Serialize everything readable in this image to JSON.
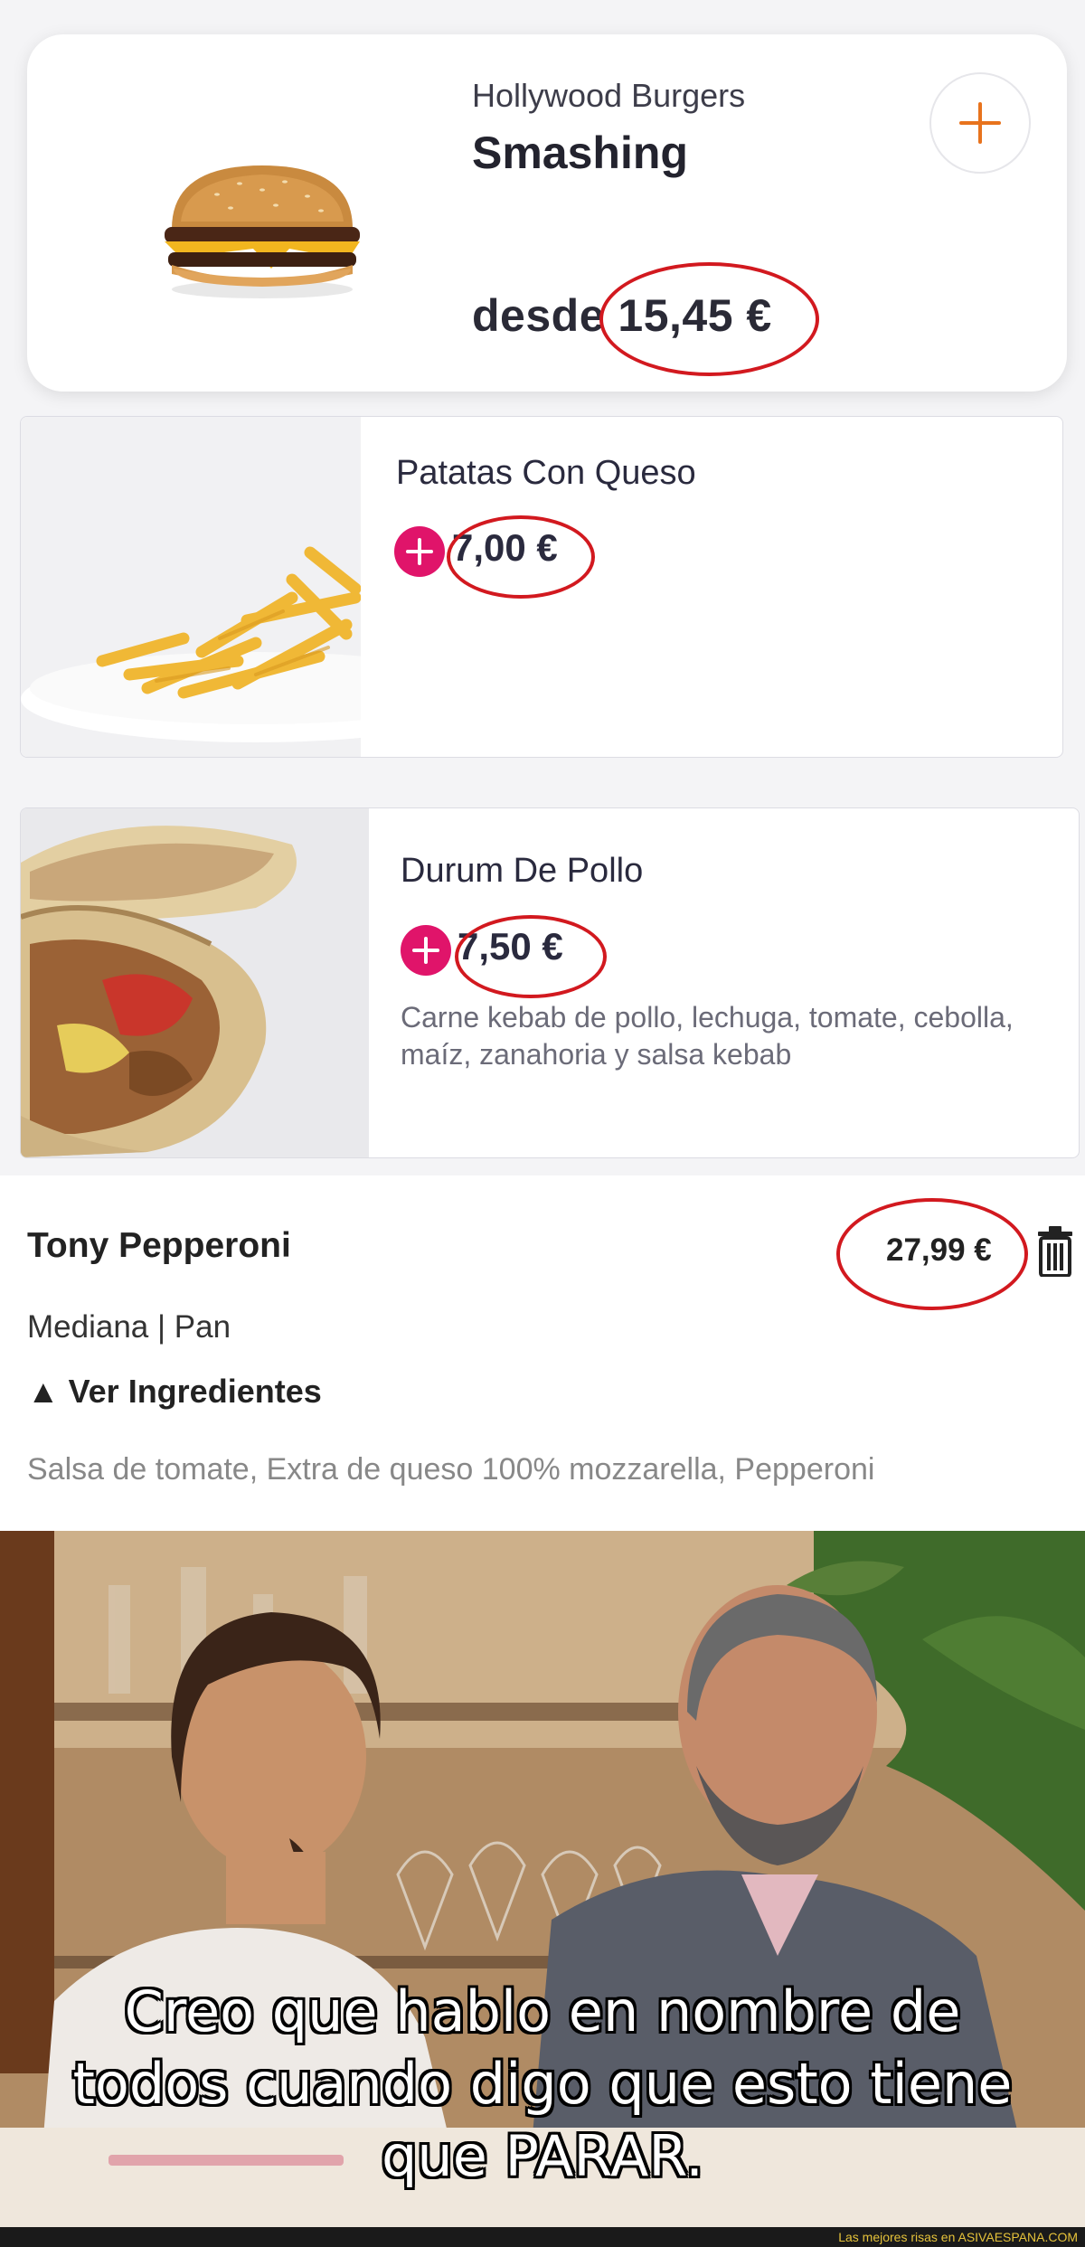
{
  "card1": {
    "restaurant": "Hollywood Burgers",
    "name": "Smashing",
    "price": "desde 15,45 €",
    "image": "burger"
  },
  "card2": {
    "name": "Patatas Con Queso",
    "price": "7,00 €",
    "image": "fries"
  },
  "card3": {
    "name": "Durum De Pollo",
    "price": "7,50 €",
    "description": "Carne kebab de pollo, lechuga, tomate, cebolla, maíz, zanahoria y salsa kebab",
    "image": "durum"
  },
  "cart": {
    "name": "Tony Pepperoni",
    "price": "27,99 €",
    "options": "Mediana | Pan",
    "toggle": "▲ Ver Ingredientes",
    "ingredients": "Salsa de tomate, Extra de queso 100% mozzarella, Pepperoni"
  },
  "meme": {
    "caption_line1": "Creo que hablo en nombre de",
    "caption_line2": "todos cuando digo que esto tiene",
    "caption_line3": "que PARAR."
  },
  "footer": {
    "text": "Las mejores risas en ASIVAESPANA.COM"
  },
  "colors": {
    "accent_orange": "#e8731d",
    "accent_pink": "#e0146a",
    "annotation_red": "#d2191f"
  }
}
